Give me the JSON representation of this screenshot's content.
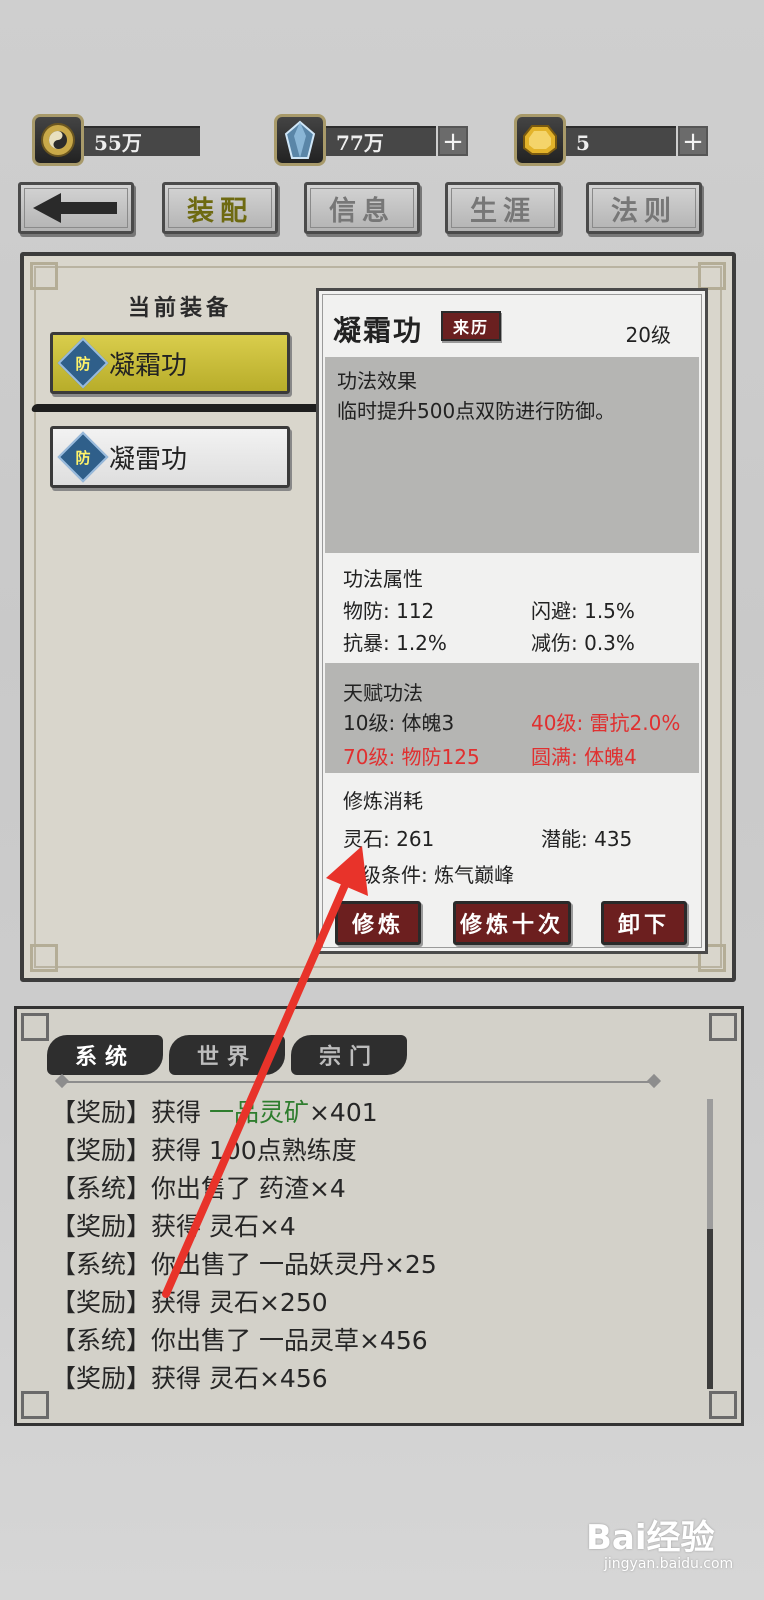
{
  "currency": {
    "coins": "55万",
    "crystals": "77万",
    "gold": "5",
    "plus": "+"
  },
  "nav": {
    "back": "back",
    "tabs": [
      "装配",
      "信息",
      "生涯",
      "法则"
    ],
    "active_tab": "装配"
  },
  "equipment": {
    "title": "当前装备",
    "badge": "防",
    "items": [
      {
        "label": "凝霜功",
        "selected": true
      },
      {
        "label": "凝雷功",
        "selected": false
      }
    ]
  },
  "detail": {
    "name": "凝霜功",
    "origin_button": "来历",
    "level": "20级",
    "effect_title": "功法效果",
    "effect_text": "临时提升500点双防进行防御。",
    "attr_title": "功法属性",
    "attrs": [
      {
        "text": "物防: 112"
      },
      {
        "text": "闪避: 1.5%"
      },
      {
        "text": "抗暴: 1.2%"
      },
      {
        "text": "减伤: 0.3%"
      }
    ],
    "talent_title": "天赋功法",
    "talents": [
      {
        "text": "10级: 体魄3",
        "unlocked": true
      },
      {
        "text": "40级: 雷抗2.0%",
        "unlocked": false
      },
      {
        "text": "70级: 物防125",
        "unlocked": false
      },
      {
        "text": "圆满: 体魄4",
        "unlocked": false
      }
    ],
    "cost_title": "修炼消耗",
    "spirit_stone": "灵石: 261",
    "potential": "潜能: 435",
    "upgrade_condition": "级条件: 炼气巅峰",
    "buttons": {
      "train": "修炼",
      "train_ten": "修炼十次",
      "unequip": "卸下"
    }
  },
  "chat": {
    "tabs": [
      "系统",
      "世界",
      "宗门"
    ],
    "messages": [
      {
        "tag": "【奖励】",
        "text": "获得 ",
        "item": "一品灵矿",
        "suffix": "×401"
      },
      {
        "tag": "【奖励】",
        "text": "获得 100点熟练度",
        "item": "",
        "suffix": ""
      },
      {
        "tag": "【系统】",
        "text": "你出售了 药渣×4",
        "item": "",
        "suffix": ""
      },
      {
        "tag": "【奖励】",
        "text": "获得 灵石×4",
        "item": "",
        "suffix": ""
      },
      {
        "tag": "【系统】",
        "text": "你出售了 一品妖灵丹×25",
        "item": "",
        "suffix": ""
      },
      {
        "tag": "【奖励】",
        "text": "获得 灵石×250",
        "item": "",
        "suffix": ""
      },
      {
        "tag": "【系统】",
        "text": "你出售了 一品灵草×456",
        "item": "",
        "suffix": ""
      },
      {
        "tag": "【奖励】",
        "text": "获得 灵石×456",
        "item": "",
        "suffix": ""
      }
    ]
  },
  "watermark": {
    "brand": "Bai经验",
    "url": "jingyan.baidu.com"
  },
  "colors": {
    "accent_yellow": "#d9cd4c",
    "button_red": "#6c1f1f",
    "talent_locked": "#e03030",
    "item_green": "#2e7d2e",
    "annotation_arrow": "#e8332a"
  }
}
